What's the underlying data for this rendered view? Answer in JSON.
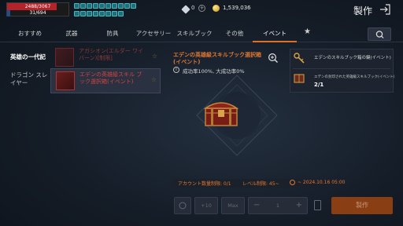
{
  "status": {
    "hp_text": "2488/3067",
    "hp_fraction": 0.81,
    "mp_text": "31/694",
    "mp_fraction": 0.045,
    "gem_count": "0",
    "gem_add": "+",
    "coin_count": "1,539,036"
  },
  "header": {
    "title": "製作"
  },
  "tabs": [
    {
      "label": "おすすめ"
    },
    {
      "label": "武器"
    },
    {
      "label": "防具"
    },
    {
      "label": "アクセサリー"
    },
    {
      "label": "スキルブック"
    },
    {
      "label": "その他"
    },
    {
      "label": "イベント",
      "active": true
    }
  ],
  "tab_star": "★",
  "sidebar": {
    "items": [
      {
        "label": "英雄の一代記",
        "active": true
      },
      {
        "label": "ドラゴン スレイヤー"
      }
    ]
  },
  "list": {
    "items": [
      {
        "name": "アガシオン(エルダー ワイバーン)[制限]",
        "fav": "☆"
      },
      {
        "name": "エデンの英雄級スキル ブック選択箱(イベント)",
        "fav": "☆",
        "selected": true
      }
    ]
  },
  "detail": {
    "title": "エデンの英雄級スキルブック選択箱 (イベント)",
    "info_symbol": "i",
    "rate": "成功率100%, 大成功率0%",
    "limit_account": "アカウント数量制限: 0/1",
    "limit_level": "レベル制限: 45~",
    "limit_date": "~ 2024.10.16 05:00"
  },
  "controls": {
    "plus10": "+10",
    "max": "Max",
    "minus": "−",
    "quantity": "1",
    "plus": "+",
    "craft": "製作"
  },
  "materials": [
    {
      "name": "エデンのスキルブック箱の鍵(イベント)",
      "qty": ""
    },
    {
      "name": "エデンの封印された英雄級スキルブック(イベント)",
      "qty": "2/1"
    }
  ],
  "colors": {
    "accent": "#e07028",
    "item_name": "#d24444",
    "hp": "#b3232a",
    "mp": "#1f4f8a"
  }
}
